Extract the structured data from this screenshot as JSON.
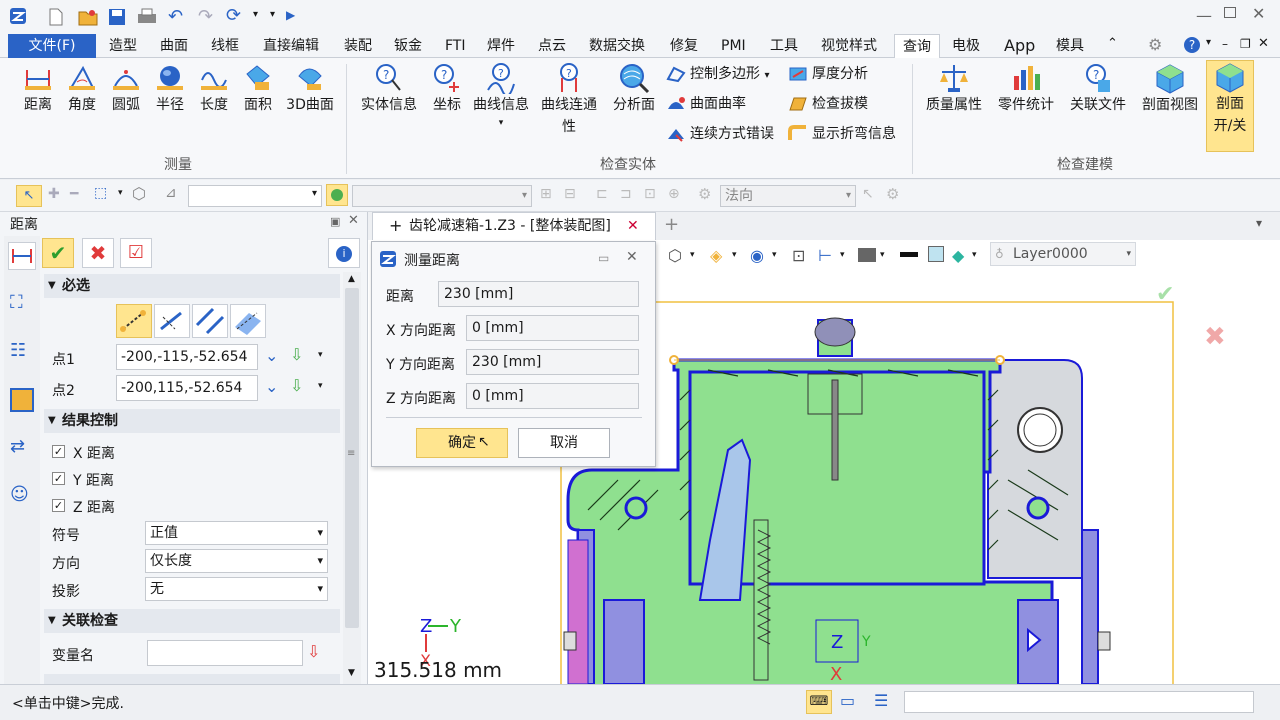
{
  "menu": {
    "file": "文件(F)",
    "items": [
      "造型",
      "曲面",
      "线框",
      "直接编辑",
      "装配",
      "钣金",
      "FTI",
      "焊件",
      "点云",
      "数据交换",
      "修复",
      "PMI",
      "工具",
      "视觉样式",
      "查询",
      "电极",
      "App",
      "模具"
    ]
  },
  "ribbon": {
    "measure": {
      "label": "测量",
      "buttons": [
        "距离",
        "角度",
        "圆弧",
        "半径",
        "长度",
        "面积",
        "3D曲面"
      ]
    },
    "inspect": {
      "label": "检查实体",
      "buttons": [
        "实体信息",
        "坐标",
        "曲线信息"
      ],
      "curve_cont": [
        "曲线连通",
        "性"
      ],
      "analysis": "分析面",
      "small": [
        "控制多边形",
        "曲面曲率",
        "连续方式错误",
        "厚度分析",
        "检查拔模",
        "显示折弯信息"
      ]
    },
    "model": {
      "label": "检查建模",
      "buttons": [
        "质量属性",
        "零件统计",
        "关联文件",
        "剖面视图"
      ],
      "section_toggle": [
        "剖面",
        "开/关"
      ]
    }
  },
  "toolbar": {
    "direction": "法向"
  },
  "panel": {
    "title": "距离",
    "required": "必选",
    "p1_label": "点1",
    "p1_value": "-200,-115,-52.654",
    "p2_label": "点2",
    "p2_value": "-200,115,-52.654",
    "result": "结果控制",
    "checks": [
      "X 距离",
      "Y 距离",
      "Z 距离"
    ],
    "sign_label": "符号",
    "sign_value": "正值",
    "dir_label": "方向",
    "dir_value": "仅长度",
    "proj_label": "投影",
    "proj_value": "无",
    "assoc": "关联检查",
    "var_label": "变量名"
  },
  "doc": {
    "tab": "齿轮减速箱-1.Z3 - [整体装配图]",
    "layer": "Layer0000",
    "measure_readout": "315.518 mm"
  },
  "dialog": {
    "title": "测量距离",
    "rows": [
      {
        "label": "距离",
        "value": "230  [mm]"
      },
      {
        "label": "X 方向距离",
        "value": "0  [mm]"
      },
      {
        "label": "Y 方向距离",
        "value": "230  [mm]"
      },
      {
        "label": "Z 方向距离",
        "value": "0  [mm]"
      }
    ],
    "ok": "确定",
    "cancel": "取消"
  },
  "status": {
    "hint": "<单击中键>完成."
  },
  "colors": {
    "accent": "#2a63c6",
    "highlight": "#ffe58f",
    "model_green": "#8fe08f",
    "outline_blue": "#1a1ad8"
  }
}
